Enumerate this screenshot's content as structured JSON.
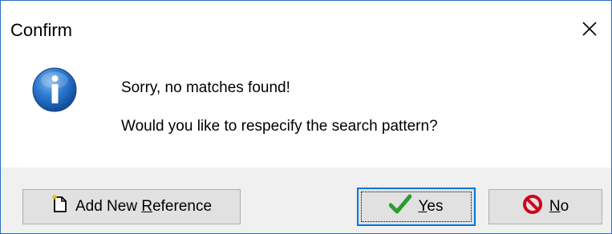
{
  "window": {
    "title": "Confirm"
  },
  "message": {
    "line1": "Sorry, no matches found!",
    "line2": "Would you like to respecify the search pattern?"
  },
  "buttons": {
    "add_reference": {
      "pre": "Add New ",
      "accel": "R",
      "post": "eference"
    },
    "yes": {
      "accel": "Y",
      "post": "es"
    },
    "no": {
      "accel": "N",
      "post": "o"
    }
  },
  "colors": {
    "accent": "#0078d7",
    "info_blue": "#1f6fc4",
    "no_red": "#d0021b",
    "yes_green": "#2e9b2e",
    "footer_bg": "#f0f0f0"
  },
  "icons": {
    "info": "info-icon",
    "close": "close-icon",
    "add_reference": "new-document-icon",
    "yes": "checkmark-icon",
    "no": "prohibited-icon"
  }
}
